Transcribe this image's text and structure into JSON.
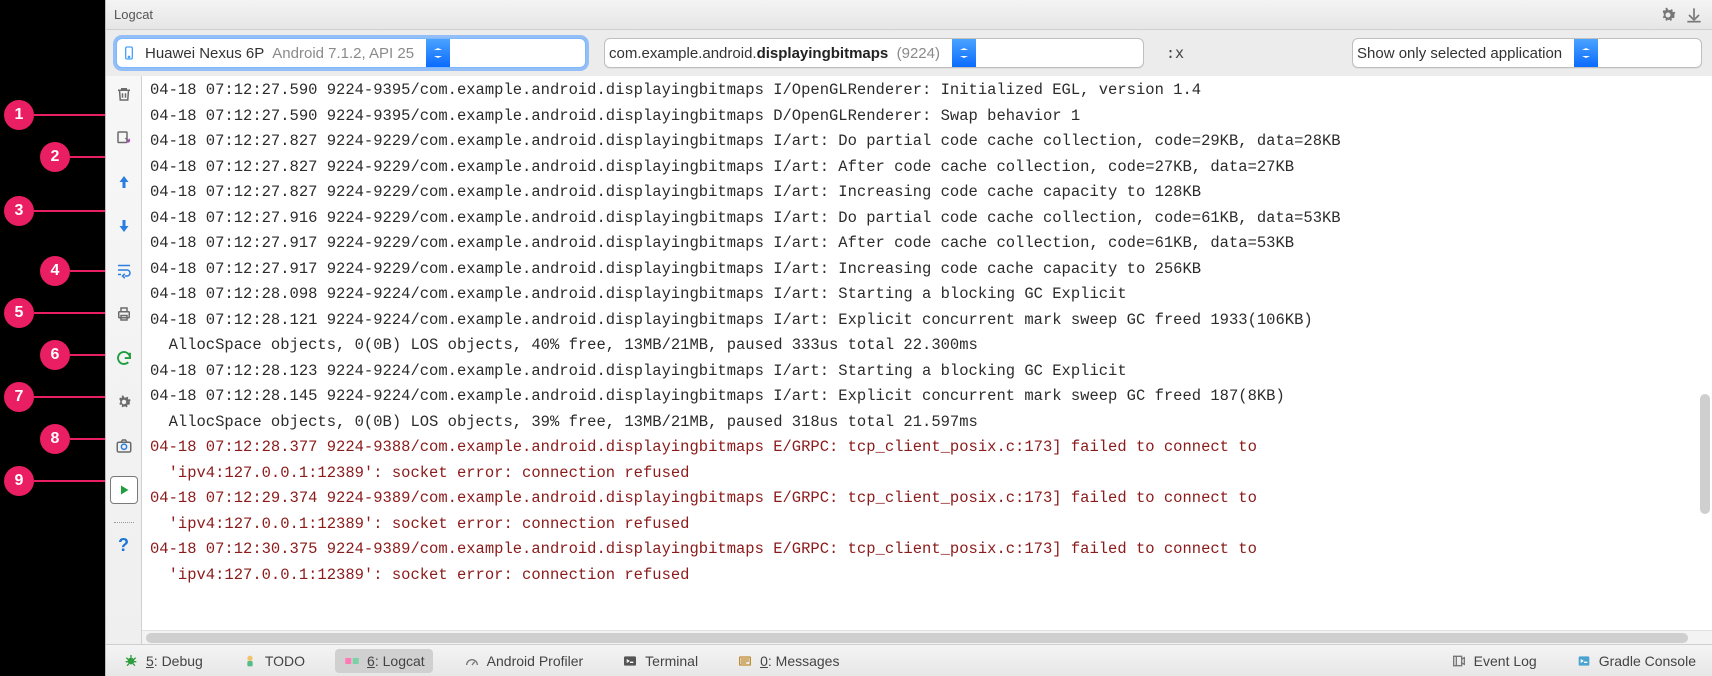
{
  "callouts": [
    "1",
    "2",
    "3",
    "4",
    "5",
    "6",
    "7",
    "8",
    "9"
  ],
  "titlebar": {
    "title": "Logcat"
  },
  "filters": {
    "device": {
      "name": "Huawei Nexus 6P",
      "detail": "Android 7.1.2, API 25"
    },
    "process": {
      "pkg_prefix": "com.example.android.",
      "pkg_bold": "displayingbitmaps",
      "pid": "(9224)"
    },
    "regex_hint": ":x",
    "mode": "Show only selected application"
  },
  "gutter": {
    "clear": "Clear",
    "scroll_end": "Scroll to end",
    "up": "Up stack",
    "down": "Down stack",
    "wrap": "Soft-wrap",
    "print": "Print",
    "restart": "Restart",
    "settings": "Settings",
    "screenshot": "Screenshot",
    "record": "Screen Record",
    "help": "?"
  },
  "log_lines": [
    {
      "lvl": "I",
      "text": "04-18 07:12:27.590 9224-9395/com.example.android.displayingbitmaps I/OpenGLRenderer: Initialized EGL, version 1.4"
    },
    {
      "lvl": "D",
      "text": "04-18 07:12:27.590 9224-9395/com.example.android.displayingbitmaps D/OpenGLRenderer: Swap behavior 1"
    },
    {
      "lvl": "I",
      "text": "04-18 07:12:27.827 9224-9229/com.example.android.displayingbitmaps I/art: Do partial code cache collection, code=29KB, data=28KB"
    },
    {
      "lvl": "I",
      "text": "04-18 07:12:27.827 9224-9229/com.example.android.displayingbitmaps I/art: After code cache collection, code=27KB, data=27KB"
    },
    {
      "lvl": "I",
      "text": "04-18 07:12:27.827 9224-9229/com.example.android.displayingbitmaps I/art: Increasing code cache capacity to 128KB"
    },
    {
      "lvl": "I",
      "text": "04-18 07:12:27.916 9224-9229/com.example.android.displayingbitmaps I/art: Do partial code cache collection, code=61KB, data=53KB"
    },
    {
      "lvl": "I",
      "text": "04-18 07:12:27.917 9224-9229/com.example.android.displayingbitmaps I/art: After code cache collection, code=61KB, data=53KB"
    },
    {
      "lvl": "I",
      "text": "04-18 07:12:27.917 9224-9229/com.example.android.displayingbitmaps I/art: Increasing code cache capacity to 256KB"
    },
    {
      "lvl": "I",
      "text": "04-18 07:12:28.098 9224-9224/com.example.android.displayingbitmaps I/art: Starting a blocking GC Explicit"
    },
    {
      "lvl": "I",
      "text": "04-18 07:12:28.121 9224-9224/com.example.android.displayingbitmaps I/art: Explicit concurrent mark sweep GC freed 1933(106KB)\n  AllocSpace objects, 0(0B) LOS objects, 40% free, 13MB/21MB, paused 333us total 22.300ms"
    },
    {
      "lvl": "I",
      "text": "04-18 07:12:28.123 9224-9224/com.example.android.displayingbitmaps I/art: Starting a blocking GC Explicit"
    },
    {
      "lvl": "I",
      "text": "04-18 07:12:28.145 9224-9224/com.example.android.displayingbitmaps I/art: Explicit concurrent mark sweep GC freed 187(8KB)\n  AllocSpace objects, 0(0B) LOS objects, 39% free, 13MB/21MB, paused 318us total 21.597ms"
    },
    {
      "lvl": "E",
      "text": "04-18 07:12:28.377 9224-9388/com.example.android.displayingbitmaps E/GRPC: tcp_client_posix.c:173] failed to connect to\n  'ipv4:127.0.0.1:12389': socket error: connection refused"
    },
    {
      "lvl": "E",
      "text": "04-18 07:12:29.374 9224-9389/com.example.android.displayingbitmaps E/GRPC: tcp_client_posix.c:173] failed to connect to\n  'ipv4:127.0.0.1:12389': socket error: connection refused"
    },
    {
      "lvl": "E",
      "text": "04-18 07:12:30.375 9224-9389/com.example.android.displayingbitmaps E/GRPC: tcp_client_posix.c:173] failed to connect to\n  'ipv4:127.0.0.1:12389': socket error: connection refused"
    }
  ],
  "status": {
    "debug": "5: Debug",
    "todo": "TODO",
    "logcat": "6: Logcat",
    "profiler": "Android Profiler",
    "terminal": "Terminal",
    "messages": "0: Messages",
    "eventlog": "Event Log",
    "gradle": "Gradle Console"
  }
}
